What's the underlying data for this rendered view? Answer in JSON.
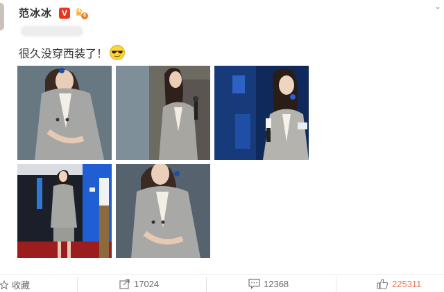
{
  "author": {
    "name": "范冰冰",
    "verified_badge": "V",
    "vip_level": "6"
  },
  "post": {
    "text": "很久没穿西装了！",
    "emoji": "sunglasses-face-icon"
  },
  "photos": [
    {
      "alt": "photo-1"
    },
    {
      "alt": "photo-2"
    },
    {
      "alt": "photo-3"
    },
    {
      "alt": "photo-4"
    },
    {
      "alt": "photo-5"
    }
  ],
  "actions": {
    "favorite_label": "收藏",
    "forward_count": "17024",
    "comment_count": "12368",
    "like_count": "225311"
  },
  "colors": {
    "verified_red": "#e8361d",
    "like_orange": "#eb7350",
    "suit_gray": "#9a9c9e"
  }
}
